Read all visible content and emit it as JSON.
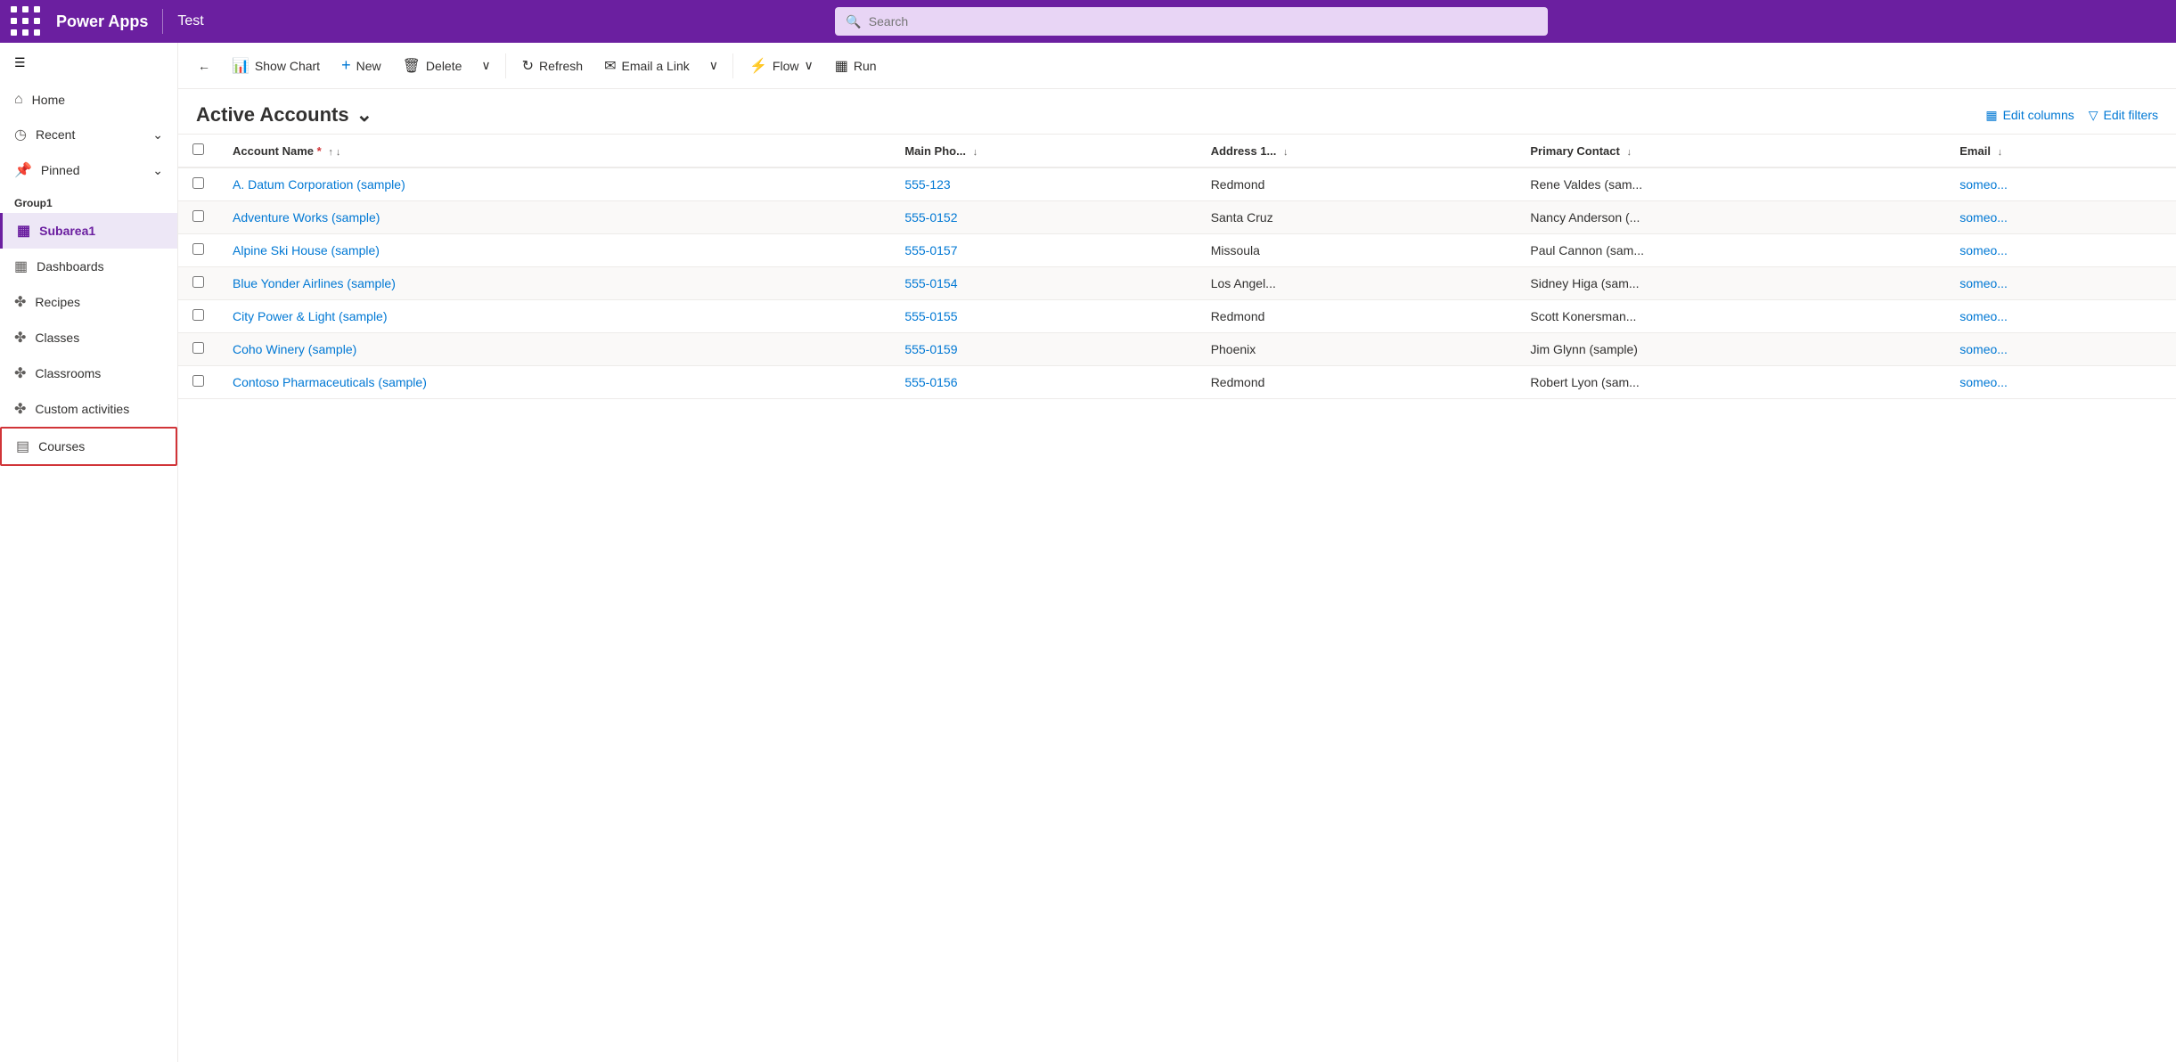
{
  "topbar": {
    "app_name": "Power Apps",
    "divider": "|",
    "test_label": "Test",
    "search_placeholder": "Search"
  },
  "toolbar": {
    "back_label": "←",
    "show_chart_label": "Show Chart",
    "new_label": "New",
    "delete_label": "Delete",
    "refresh_label": "Refresh",
    "email_link_label": "Email a Link",
    "flow_label": "Flow",
    "run_label": "Run"
  },
  "view": {
    "title": "Active Accounts",
    "edit_columns_label": "Edit columns",
    "edit_filters_label": "Edit filters"
  },
  "table": {
    "columns": [
      {
        "id": "account_name",
        "label": "Account Name",
        "required": true,
        "sortable": true
      },
      {
        "id": "main_phone",
        "label": "Main Pho...",
        "sortable": true
      },
      {
        "id": "address",
        "label": "Address 1...",
        "sortable": true
      },
      {
        "id": "primary_contact",
        "label": "Primary Contact",
        "sortable": true
      },
      {
        "id": "email",
        "label": "Email",
        "sortable": true
      }
    ],
    "rows": [
      {
        "account_name": "A. Datum Corporation (sample)",
        "main_phone": "555-123",
        "address": "Redmond",
        "primary_contact": "Rene Valdes (sam...",
        "email": "someo..."
      },
      {
        "account_name": "Adventure Works (sample)",
        "main_phone": "555-0152",
        "address": "Santa Cruz",
        "primary_contact": "Nancy Anderson (...",
        "email": "someo..."
      },
      {
        "account_name": "Alpine Ski House (sample)",
        "main_phone": "555-0157",
        "address": "Missoula",
        "primary_contact": "Paul Cannon (sam...",
        "email": "someo..."
      },
      {
        "account_name": "Blue Yonder Airlines (sample)",
        "main_phone": "555-0154",
        "address": "Los Angel...",
        "primary_contact": "Sidney Higa (sam...",
        "email": "someo..."
      },
      {
        "account_name": "City Power & Light (sample)",
        "main_phone": "555-0155",
        "address": "Redmond",
        "primary_contact": "Scott Konersman...",
        "email": "someo..."
      },
      {
        "account_name": "Coho Winery (sample)",
        "main_phone": "555-0159",
        "address": "Phoenix",
        "primary_contact": "Jim Glynn (sample)",
        "email": "someo..."
      },
      {
        "account_name": "Contoso Pharmaceuticals (sample)",
        "main_phone": "555-0156",
        "address": "Redmond",
        "primary_contact": "Robert Lyon (sam...",
        "email": "someo..."
      }
    ]
  },
  "sidebar": {
    "nav_items": [
      {
        "id": "home",
        "label": "Home",
        "icon": "⌂"
      },
      {
        "id": "recent",
        "label": "Recent",
        "icon": "⊙",
        "chevron": true
      },
      {
        "id": "pinned",
        "label": "Pinned",
        "icon": "📌",
        "chevron": true
      }
    ],
    "group_label": "Group1",
    "group_items": [
      {
        "id": "subarea1",
        "label": "Subarea1",
        "icon": "▦",
        "active": true
      },
      {
        "id": "dashboards",
        "label": "Dashboards",
        "icon": "▦"
      },
      {
        "id": "recipes",
        "label": "Recipes",
        "icon": "✤"
      },
      {
        "id": "classes",
        "label": "Classes",
        "icon": "✤"
      },
      {
        "id": "classrooms",
        "label": "Classrooms",
        "icon": "✤"
      },
      {
        "id": "custom-activities",
        "label": "Custom activities",
        "icon": "✤"
      },
      {
        "id": "courses",
        "label": "Courses",
        "icon": "▤",
        "highlighted": true
      }
    ]
  },
  "icons": {
    "grid_icon": "⠿",
    "home_icon": "⌂",
    "recent_icon": "◷",
    "pinned_icon": "📌",
    "chevron_down": "⌄",
    "back_arrow": "←",
    "show_chart_icon": "📊",
    "new_icon": "+",
    "delete_icon": "🗑",
    "refresh_icon": "↻",
    "email_icon": "✉",
    "flow_icon": "⚡",
    "run_icon": "▦",
    "dropdown_icon": "∨",
    "sort_asc": "↑",
    "sort_desc": "↓",
    "edit_columns_icon": "▦",
    "filter_icon": "▽",
    "search_icon": "🔍",
    "hamburger_icon": "☰"
  }
}
